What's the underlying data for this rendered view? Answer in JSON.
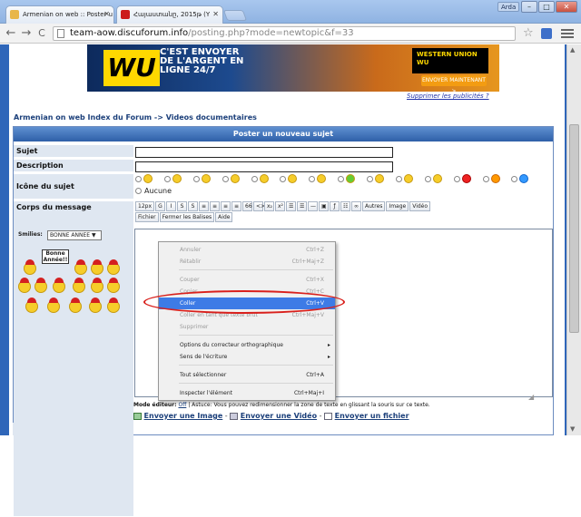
{
  "browser": {
    "tabs": [
      {
        "label": "Armenian on web :: Poster u",
        "favicon_color": "#e8b64a",
        "close": "✕"
      },
      {
        "label": "Հայաստանը, 2015թ (Y",
        "favicon_color": "#cc1b1b",
        "close": "✕"
      }
    ],
    "user": "Arda",
    "window_buttons": [
      "–",
      "□",
      "✕"
    ],
    "url_host": "team-aow.discuforum.info",
    "url_path": "/posting.php?mode=newtopic&f=33",
    "back": "←",
    "forward": "→",
    "reload": "C",
    "bookmark_star": "☆"
  },
  "banner": {
    "logo": "WU",
    "headline": "C'EST ENVOYER DE L'ARGENT EN LIGNE 24/7",
    "brand_box": "WESTERN UNION WU",
    "cta": "ENVOYER MAINTENANT >"
  },
  "ads_link": "Supprimer les publicités ?",
  "breadcrumb": "Armenian on web Index du Forum -> Videos documentaires",
  "form": {
    "header": "Poster un nouveau sujet",
    "labels": {
      "subject": "Sujet",
      "description": "Description",
      "icon": "Icône du sujet",
      "body": "Corps du message"
    },
    "icon_none": "Aucune",
    "smilies_label": "Smilies:",
    "smilies_select": "BONNE ANNEE ▼",
    "bonne_annee": "Bonne Année!!",
    "toolbar": {
      "row1": [
        "12px",
        "G",
        "I",
        "S",
        "S",
        "≡",
        "≡",
        "≡",
        "≡",
        "66",
        "<>",
        "x₂",
        "x²",
        "☰",
        "☰",
        "—",
        "▣",
        "ƒ",
        "☷",
        "∞",
        "Autres",
        "Image",
        "Vidéo"
      ],
      "row2": [
        "Fichier",
        "Fermer les Balises",
        "Aide"
      ]
    },
    "mode_label": "Mode éditeur:",
    "mode_value": "Off",
    "hint": "| Astuce: Vous pouvez redimensionner la zone de texte en glissant la souris sur ce texte.",
    "links": [
      "Envoyer une Image",
      "Envoyer une Vidéo",
      "Envoyer un fichier"
    ]
  },
  "context_menu": [
    {
      "label": "Annuler",
      "shortcut": "Ctrl+Z",
      "disabled": true
    },
    {
      "label": "Rétablir",
      "shortcut": "Ctrl+Maj+Z",
      "disabled": true
    },
    {
      "label": "Couper",
      "shortcut": "Ctrl+X",
      "disabled": true
    },
    {
      "label": "Copier",
      "shortcut": "Ctrl+C",
      "disabled": true
    },
    {
      "label": "Coller",
      "shortcut": "Ctrl+V",
      "disabled": false,
      "highlighted": true
    },
    {
      "label": "Coller en tant que texte brut",
      "shortcut": "Ctrl+Maj+V",
      "disabled": true
    },
    {
      "label": "Supprimer",
      "shortcut": "",
      "disabled": true
    },
    {
      "label": "Options du correcteur orthographique",
      "shortcut": "▸",
      "disabled": false
    },
    {
      "label": "Sens de l'écriture",
      "shortcut": "▸",
      "disabled": false
    },
    {
      "label": "Tout sélectionner",
      "shortcut": "Ctrl+A",
      "disabled": false
    },
    {
      "label": "Inspecter l'élément",
      "shortcut": "Ctrl+Maj+I",
      "disabled": false
    }
  ],
  "colors": {
    "chrome_title": "#a9c7ee",
    "page_bg": "#2f66b9",
    "form_header": "#2e5fa8",
    "label_bg": "#dfe7f1",
    "link": "#1b3f7a",
    "highlight": "#3d7be6",
    "annotation_ellipse": "#d9201c"
  }
}
